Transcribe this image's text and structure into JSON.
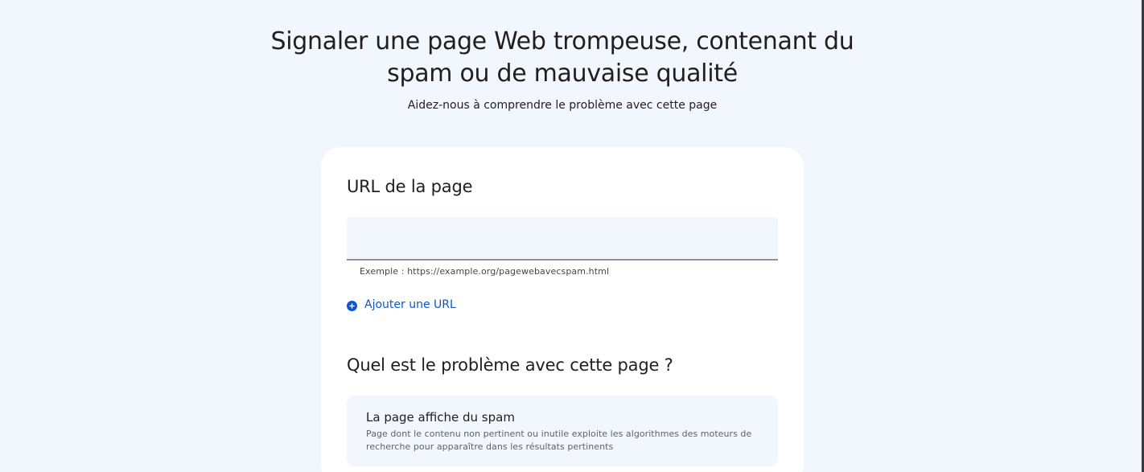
{
  "header": {
    "title_line1": "Signaler une page Web trompeuse, contenant du",
    "title_line2": "spam ou de mauvaise qualité",
    "subtitle": "Aidez-nous à comprendre le problème avec cette page"
  },
  "form": {
    "url_section": {
      "heading": "URL de la page",
      "input_value": "",
      "helper_text": "Exemple : https://example.org/pagewebavecspam.html",
      "add_url_label": "Ajouter une URL",
      "add_url_icon": "add-circle-icon"
    },
    "problem_section": {
      "heading": "Quel est le problème avec cette page ?",
      "options": [
        {
          "title": "La page affiche du spam",
          "description_line1": "Page dont le contenu non pertinent ou inutile exploite les algorithmes des moteurs de",
          "description_line2": "recherche pour apparaître dans les résultats pertinents"
        }
      ]
    }
  },
  "colors": {
    "background": "#f2f6fd",
    "card": "#ffffff",
    "link": "#0b57d0",
    "text": "#1f1f1f"
  }
}
